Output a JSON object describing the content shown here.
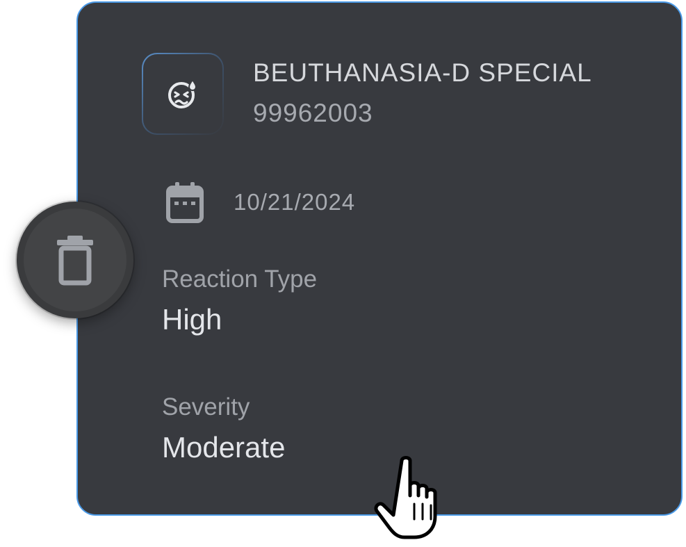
{
  "allergy_card": {
    "drug_name": "BEUTHANASIA-D SPECIAL",
    "drug_code": "99962003",
    "drug_icon": "sick-face-icon",
    "date": "10/21/2024",
    "date_icon": "calendar-icon",
    "reaction_type": {
      "label": "Reaction Type",
      "value": "High"
    },
    "severity": {
      "label": "Severity",
      "value": "Moderate"
    }
  },
  "delete_button": {
    "icon": "trash-icon"
  },
  "cursor": {
    "icon": "hand-pointer-icon"
  },
  "colors": {
    "card_background": "#383a3f",
    "card_border": "#4a9ae8",
    "primary_text": "#e4e6ea",
    "secondary_text": "#a7aab0",
    "delete_button": "#434446"
  }
}
